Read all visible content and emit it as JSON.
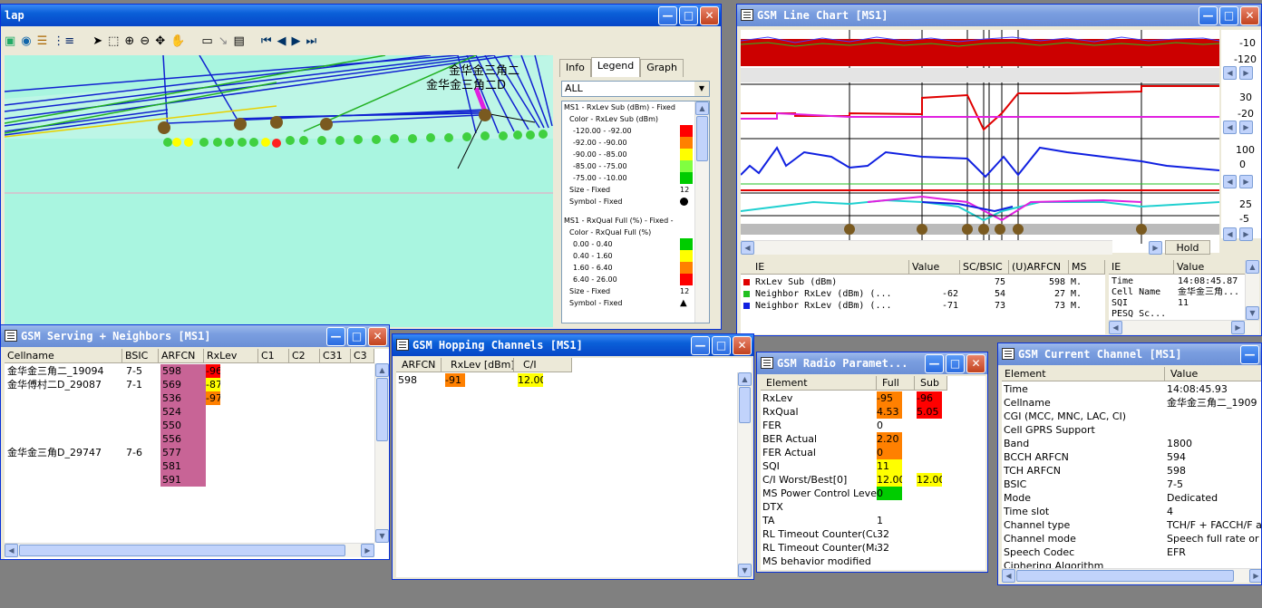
{
  "map": {
    "title": "lap",
    "labels": [
      "金华金三角二",
      "金华金三角二D"
    ],
    "tabs": [
      "Info",
      "Legend",
      "Graph"
    ],
    "filter_value": "ALL",
    "legend": {
      "l1": "MS1 - RxLev Sub (dBm) - Fixed",
      "l2": "Color - RxLev Sub (dBm)",
      "rows1": [
        "-120.00 - -92.00",
        "-92.00 - -90.00",
        "-90.00 - -85.00",
        "-85.00 - -75.00",
        "-75.00 - -10.00"
      ],
      "colors1": [
        "#ff0000",
        "#ff8000",
        "#ffff00",
        "#80ff40",
        "#00cc00"
      ],
      "size1": "Size - Fixed",
      "size1v": "12",
      "sym1": "Symbol - Fixed",
      "l3": "MS1 - RxQual Full (%) - Fixed -",
      "l4": "Color - RxQual Full (%)",
      "rows2": [
        "0.00 - 0.40",
        "0.40 - 1.60",
        "1.60 - 6.40",
        "6.40 - 26.00"
      ],
      "colors2": [
        "#00cc00",
        "#ffff00",
        "#ff8000",
        "#ff0000"
      ],
      "size2": "Size - Fixed",
      "size2v": "12",
      "sym2": "Symbol - Fixed"
    }
  },
  "linechart": {
    "title": "GSM Line Chart [MS1]",
    "axis": [
      [
        "-10",
        "-120"
      ],
      [
        "30",
        "-20"
      ],
      [
        "100",
        "0"
      ],
      [
        "25",
        "-5"
      ]
    ],
    "hold": "Hold",
    "ie_headers": [
      "IE",
      "Value",
      "SC/BSIC",
      "(U)ARFCN",
      "MS"
    ],
    "ie_rows": [
      [
        "RxLev Sub (dBm)",
        "",
        "75",
        "598",
        "M."
      ],
      [
        "Neighbor RxLev (dBm) (...",
        "-62",
        "54",
        "27",
        "M."
      ],
      [
        "Neighbor RxLev (dBm) (...",
        "-71",
        "73",
        "73",
        "M."
      ]
    ],
    "ie_colors": [
      "#e00000",
      "#20c020",
      "#1020e0"
    ],
    "info_headers": [
      "IE",
      "Value"
    ],
    "info_rows": [
      [
        "Time",
        "14:08:45.87"
      ],
      [
        "Cell Name",
        "金华金三角..."
      ],
      [
        "SQI",
        "11"
      ],
      [
        "PESQ Sc...",
        ""
      ]
    ]
  },
  "serving": {
    "title": "GSM Serving + Neighbors [MS1]",
    "headers": [
      "Cellname",
      "BSIC",
      "ARFCN",
      "RxLev",
      "C1",
      "C2",
      "C31",
      "C3"
    ],
    "cellnames": [
      [
        "金华金三角二_19094",
        "7-5"
      ],
      [
        "金华傅村二D_29087",
        "7-1"
      ],
      [
        "",
        ""
      ],
      [
        "",
        ""
      ],
      [
        "",
        ""
      ],
      [
        "",
        ""
      ],
      [
        "金华金三角D_29747",
        "7-6"
      ],
      [
        "",
        ""
      ],
      [
        "",
        ""
      ]
    ],
    "arfcn": [
      "598",
      "569",
      "536",
      "524",
      "550",
      "556",
      "577",
      "581",
      "591"
    ],
    "rxlev": [
      {
        "v": "-96",
        "c": "#ff0000"
      },
      {
        "v": "-87",
        "c": "#ffff00"
      },
      {
        "v": "-97",
        "c": "#ff8000"
      }
    ]
  },
  "hopping": {
    "title": "GSM Hopping Channels [MS1]",
    "headers": [
      "ARFCN",
      "RxLev [dBm]",
      "C/I"
    ],
    "row": [
      "598",
      "-91",
      "12.00"
    ]
  },
  "radio": {
    "title": "GSM Radio Paramet...",
    "headers": [
      "Element",
      "Full",
      "Sub"
    ],
    "rows": [
      [
        "RxLev",
        "-95",
        "-96"
      ],
      [
        "RxQual",
        "4.53",
        "5.05"
      ],
      [
        "FER",
        "0",
        ""
      ],
      [
        "BER Actual",
        "2.20",
        ""
      ],
      [
        "FER Actual",
        "0",
        ""
      ],
      [
        "SQI",
        "11",
        ""
      ],
      [
        "C/I Worst/Best[0]",
        "12.00",
        "12.00"
      ],
      [
        "MS Power Control Level",
        "0",
        ""
      ],
      [
        "DTX",
        "",
        ""
      ],
      [
        "TA",
        "1",
        ""
      ],
      [
        "RL Timeout Counter(Cur)",
        "32",
        ""
      ],
      [
        "RL Timeout Counter(Max)",
        "32",
        ""
      ],
      [
        "MS behavior modified",
        "",
        ""
      ]
    ]
  },
  "current": {
    "title": "GSM Current Channel [MS1]",
    "headers": [
      "Element",
      "Value"
    ],
    "rows": [
      [
        "Time",
        "14:08:45.93"
      ],
      [
        "Cellname",
        "金华金三角二_1909"
      ],
      [
        "CGI (MCC, MNC, LAC, CI)",
        ""
      ],
      [
        "Cell GPRS Support",
        ""
      ],
      [
        "Band",
        "1800"
      ],
      [
        "BCCH ARFCN",
        "594"
      ],
      [
        "TCH ARFCN",
        "598"
      ],
      [
        "BSIC",
        "7-5"
      ],
      [
        "Mode",
        "Dedicated"
      ],
      [
        "Time slot",
        "4"
      ],
      [
        "Channel type",
        "TCH/F + FACCH/F ar"
      ],
      [
        "Channel mode",
        "Speech full rate or hal"
      ],
      [
        "Speech Codec",
        "EFR"
      ],
      [
        "Ciphering Algorithm",
        ""
      ]
    ]
  }
}
